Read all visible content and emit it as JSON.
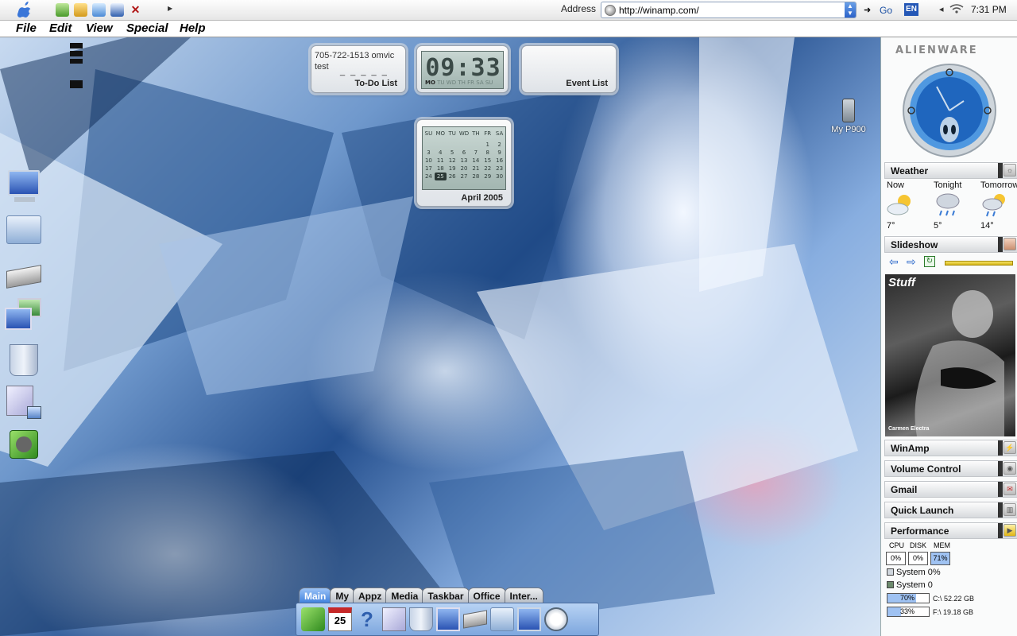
{
  "topbar": {
    "address_label": "Address",
    "address_url": "http://winamp.com/",
    "go_label": "Go",
    "lang": "EN",
    "clock": "7:31 PM"
  },
  "menubar": {
    "items": [
      "File",
      "Edit",
      "View",
      "Special",
      "Help"
    ]
  },
  "widgets": {
    "todo": {
      "line1": "705-722-1513   omvic",
      "line2": "test",
      "dashes": "_ _ _ _ _",
      "title": "To-Do List"
    },
    "clock": {
      "digits": "09:33",
      "days": [
        "MO",
        "TU",
        "WD",
        "TH",
        "FR",
        "SA",
        "SU"
      ]
    },
    "event": {
      "title": "Event List"
    },
    "calendar": {
      "headers": [
        "SU",
        "MO",
        "TU",
        "WD",
        "TH",
        "FR",
        "SA"
      ],
      "weeks": [
        [
          "",
          "",
          "",
          "",
          "",
          "1",
          "2"
        ],
        [
          "3",
          "4",
          "5",
          "6",
          "7",
          "8",
          "9"
        ],
        [
          "10",
          "11",
          "12",
          "13",
          "14",
          "15",
          "16"
        ],
        [
          "17",
          "18",
          "19",
          "20",
          "21",
          "22",
          "23"
        ],
        [
          "24",
          "25",
          "26",
          "27",
          "28",
          "29",
          "30"
        ]
      ],
      "today": "25",
      "title": "April  2005"
    }
  },
  "desktop_icons": {
    "phone_label": "My P900"
  },
  "dock": {
    "tabs": [
      "Main",
      "My",
      "Appz",
      "Media",
      "Taskbar",
      "Office",
      "Inter..."
    ],
    "active_tab": "Main",
    "calendar_icon_date": "25"
  },
  "sidebar": {
    "brand": "ALIENWARE",
    "sections": {
      "weather": "Weather",
      "slideshow": "Slideshow",
      "winamp": "WinAmp",
      "volume": "Volume Control",
      "gmail": "Gmail",
      "quicklaunch": "Quick Launch",
      "performance": "Performance"
    },
    "weather": [
      {
        "label": "Now",
        "temp": "7°"
      },
      {
        "label": "Tonight",
        "temp": "5°"
      },
      {
        "label": "Tomorrow",
        "temp": "14°"
      }
    ],
    "slideshow": {
      "magazine": "Stuff",
      "caption": "Carmen Electra"
    },
    "performance": {
      "labels": [
        "CPU",
        "DISK",
        "MEM"
      ],
      "cpu": "0%",
      "disk": "0%",
      "mem": "71%",
      "system_line1": "System 0%",
      "system_line2": "System 0",
      "drives": [
        {
          "pct": "70%",
          "fill": 0.7,
          "label": "C:\\ 52.22 GB"
        },
        {
          "pct": "33%",
          "fill": 0.33,
          "label": "F:\\ 19.18 GB"
        }
      ]
    }
  },
  "colors": {
    "accent": "#3e7fdc",
    "dock_active": "#3e7fdc"
  }
}
